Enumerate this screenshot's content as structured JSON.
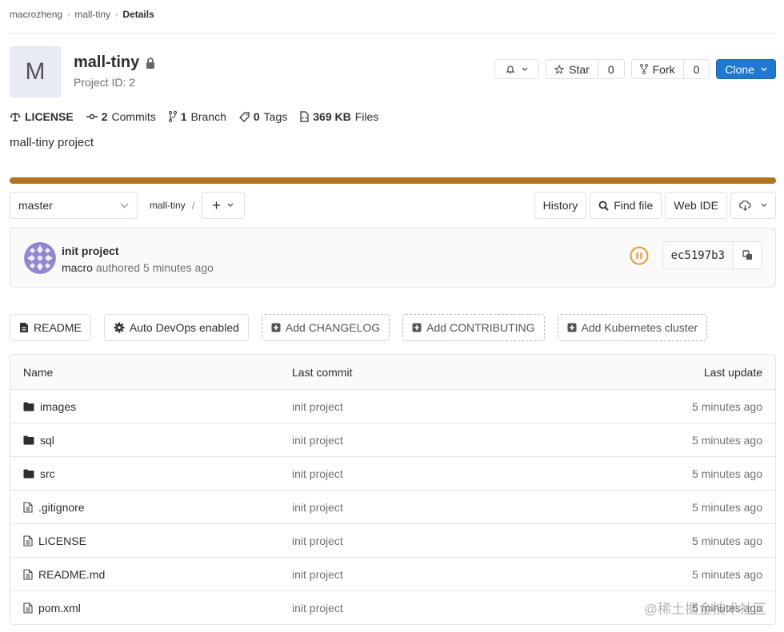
{
  "breadcrumb": [
    "macrozheng",
    "mall-tiny",
    "Details"
  ],
  "project": {
    "avatar_letter": "M",
    "name": "mall-tiny",
    "id_label": "Project ID: 2",
    "description": "mall-tiny project",
    "visibility_icon": "lock-icon"
  },
  "header_actions": {
    "notification_icon": "bell-icon",
    "star_label": "Star",
    "star_count": "0",
    "fork_label": "Fork",
    "fork_count": "0",
    "clone_label": "Clone"
  },
  "stats": {
    "license": "LICENSE",
    "commits_count": "2",
    "commits_label": "Commits",
    "branch_count": "1",
    "branch_label": "Branch",
    "tags_count": "0",
    "tags_label": "Tags",
    "files_size": "369 KB",
    "files_label": "Files"
  },
  "language_bar": {
    "color": "#b07521",
    "share": 1.0
  },
  "repo_toolbar": {
    "branch": "master",
    "path": "mall-tiny",
    "path_sep": "/",
    "add_symbol": "+",
    "history": "History",
    "find_file": "Find file",
    "web_ide": "Web IDE"
  },
  "last_commit": {
    "title": "init project",
    "author": "macro",
    "meta": "authored 5 minutes ago",
    "sha": "ec5197b3",
    "pipeline_status": "paused",
    "pipeline_color": "#f0952f"
  },
  "quick_links": [
    {
      "label": "README",
      "icon": "document-icon",
      "style": "solid"
    },
    {
      "label": "Auto DevOps enabled",
      "icon": "gear-icon",
      "style": "solid"
    },
    {
      "label": "Add CHANGELOG",
      "icon": "plus-square-icon",
      "style": "dashed"
    },
    {
      "label": "Add CONTRIBUTING",
      "icon": "plus-square-icon",
      "style": "dashed"
    },
    {
      "label": "Add Kubernetes cluster",
      "icon": "plus-square-icon",
      "style": "dashed"
    }
  ],
  "file_tree": {
    "headers": [
      "Name",
      "Last commit",
      "Last update"
    ],
    "rows": [
      {
        "name": "images",
        "type": "folder",
        "commit": "init project",
        "updated": "5 minutes ago"
      },
      {
        "name": "sql",
        "type": "folder",
        "commit": "init project",
        "updated": "5 minutes ago"
      },
      {
        "name": "src",
        "type": "folder",
        "commit": "init project",
        "updated": "5 minutes ago"
      },
      {
        "name": ".gitignore",
        "type": "file",
        "commit": "init project",
        "updated": "5 minutes ago"
      },
      {
        "name": "LICENSE",
        "type": "file",
        "commit": "init project",
        "updated": "5 minutes ago"
      },
      {
        "name": "README.md",
        "type": "file",
        "commit": "init project",
        "updated": "5 minutes ago"
      },
      {
        "name": "pom.xml",
        "type": "file",
        "commit": "init project",
        "updated": "5 minutes ago"
      }
    ]
  },
  "watermark": "@稀土掘金技术社区"
}
